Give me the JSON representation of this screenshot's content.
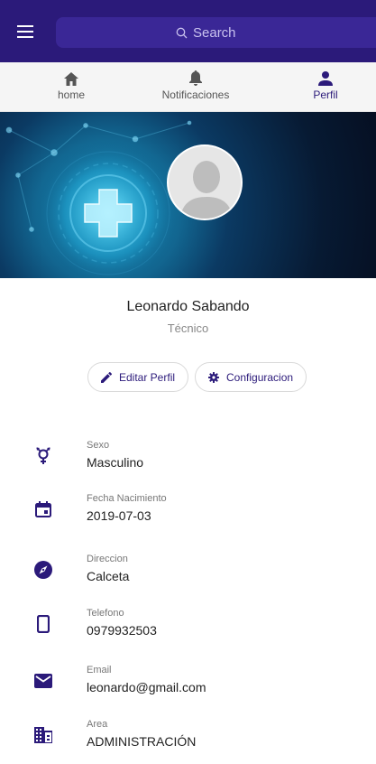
{
  "search": {
    "placeholder": "Search"
  },
  "tabs": [
    {
      "label": "home",
      "icon": "home-icon"
    },
    {
      "label": "Notificaciones",
      "icon": "bell-icon"
    },
    {
      "label": "Perfil",
      "icon": "person-icon"
    }
  ],
  "profile": {
    "name": "Leonardo Sabando",
    "role": "Técnico"
  },
  "actions": {
    "edit_label": "Editar Perfil",
    "config_label": "Configuracion"
  },
  "info": [
    {
      "label": "Sexo",
      "value": "Masculino",
      "icon": "gender-icon"
    },
    {
      "label": "Fecha Nacimiento",
      "value": "2019-07-03",
      "icon": "calendar-icon"
    },
    {
      "label": "Direccion",
      "value": "Calceta",
      "icon": "compass-icon"
    },
    {
      "label": "Telefono",
      "value": "0979932503",
      "icon": "phone-icon"
    },
    {
      "label": "Email",
      "value": "leonardo@gmail.com",
      "icon": "email-icon"
    },
    {
      "label": "Area",
      "value": "ADMINISTRACIÓN",
      "icon": "business-icon"
    }
  ],
  "colors": {
    "primary": "#2b1a7a",
    "search_bg": "#3a2796",
    "tab_bar": "#f5f5f5"
  }
}
